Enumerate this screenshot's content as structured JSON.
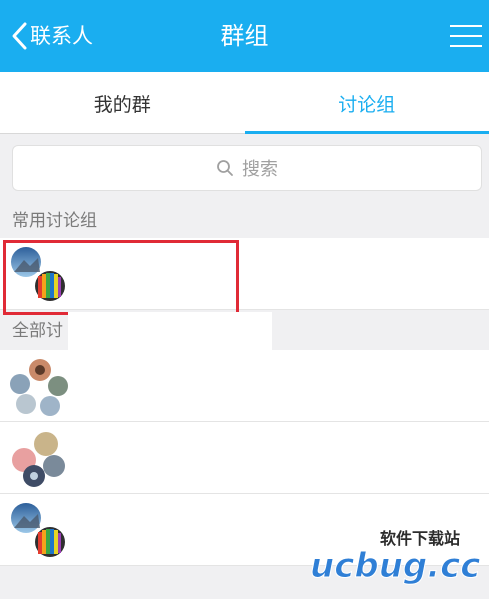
{
  "header": {
    "back_label": "联系人",
    "title": "群组",
    "background": "#1aaef0"
  },
  "tabs": [
    {
      "label": "我的群",
      "active": false
    },
    {
      "label": "讨论组",
      "active": true
    }
  ],
  "search": {
    "placeholder": "搜索",
    "icon": "search-icon"
  },
  "sections": {
    "frequent": {
      "label": "常用讨论组",
      "items": [
        {
          "avatar": "group-avatar-mountain-pencils"
        }
      ]
    },
    "all": {
      "label": "全部讨",
      "items": [
        {
          "avatar": "group-avatar-five-photos"
        },
        {
          "avatar": "group-avatar-four-photos"
        },
        {
          "avatar": "group-avatar-mountain-pencils"
        }
      ]
    }
  },
  "watermark": {
    "cn_text": "软件下载站",
    "logo_text": "ucbug.cc"
  },
  "colors": {
    "accent": "#1aaef0",
    "highlight": "#e02a36",
    "background": "#f0f0f2"
  }
}
